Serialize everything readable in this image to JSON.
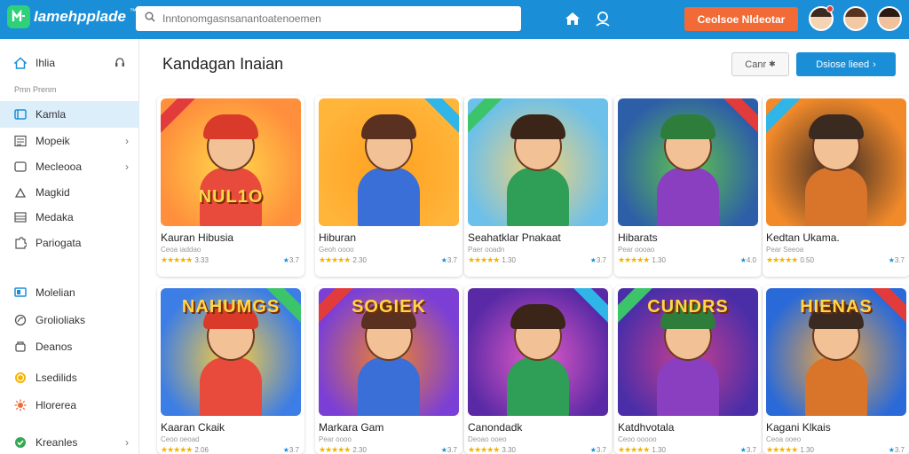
{
  "app": {
    "logo_text": "Iamehpplade",
    "logo_sup": "™",
    "search_placeholder": "Inntonomgasnsanantoatenoemen",
    "cta_label": "Ceolsoe Nldeotar"
  },
  "colors": {
    "topbar": "#1a8fd8",
    "accent": "#1a8fd8",
    "cta": "#f26a35",
    "active_item": "#ddeefb",
    "star": "#f4b400"
  },
  "sidebar": {
    "home_label": "Ihlia",
    "section_label": "Pmn Prenm",
    "items": [
      {
        "label": "Kamla",
        "icon": "book-icon",
        "active": true
      },
      {
        "label": "Mopeik",
        "icon": "list-icon",
        "chevron": true
      },
      {
        "label": "Mecleooa",
        "icon": "window-icon",
        "chevron": true
      },
      {
        "label": "Magkid",
        "icon": "triangle-icon"
      },
      {
        "label": "Medaka",
        "icon": "stack-icon"
      },
      {
        "label": "Pariogata",
        "icon": "puzzle-icon"
      },
      {
        "label": "Molelian",
        "icon": "screen-icon"
      },
      {
        "label": "Grolioliaks",
        "icon": "leaf-icon"
      },
      {
        "label": "Deanos",
        "icon": "box-icon"
      },
      {
        "label": "Lsedilids",
        "icon": "coin-icon"
      },
      {
        "label": "Hlorerea",
        "icon": "sun-icon"
      },
      {
        "label": "Kreanles",
        "icon": "check-icon",
        "chevron": true
      }
    ]
  },
  "main": {
    "title": "Kandagan Inaian",
    "secondary_button": "Canr",
    "primary_button": "Dsiose lieed"
  },
  "cards": [
    {
      "title": "Kauran Hibusia",
      "sub": "Ceoa iaddao",
      "rating_left": "3.33",
      "rating_right": "3.7",
      "art": "NUL1O",
      "tone": [
        "#ff8f3c",
        "#ffd84a"
      ]
    },
    {
      "title": "Hiburan",
      "sub": "Geoh oooo",
      "rating_left": "2.30",
      "rating_right": "3.7",
      "art": "",
      "tone": [
        "#ffb43a",
        "#ffa01f"
      ]
    },
    {
      "title": "Seahatklar Pnakaat",
      "sub": "Paer ooadn",
      "rating_left": "1.30",
      "rating_right": "3.7",
      "art": "",
      "tone": [
        "#6cc0ea",
        "#f3d27a"
      ]
    },
    {
      "title": "Hibarats",
      "sub": "Pear oooao",
      "rating_left": "1.30",
      "rating_right": "4.0",
      "art": "",
      "tone": [
        "#2d5ea8",
        "#5fc34c"
      ]
    },
    {
      "title": "Kedtan Ukama.",
      "sub": "Pear Seeoa",
      "rating_left": "0.50",
      "rating_right": "3.7",
      "art": "",
      "tone": [
        "#f28a2a",
        "#3b2a23"
      ]
    },
    {
      "title": "Kaaran Ckaik",
      "sub": "Ceoo oeoad",
      "rating_left": "2.06",
      "rating_right": "3.7",
      "art": "NAHUMGS",
      "tone": [
        "#3c7de6",
        "#ffce3b"
      ]
    },
    {
      "title": "Markara Gam",
      "sub": "Pear oooo",
      "rating_left": "2.30",
      "rating_right": "3.7",
      "art": "SOGIEK",
      "tone": [
        "#7b3fd6",
        "#f0822a"
      ]
    },
    {
      "title": "Canondadk",
      "sub": "Deoao ooeo",
      "rating_left": "3.30",
      "rating_right": "3.7",
      "art": "",
      "tone": [
        "#5a2aa6",
        "#e65bc7"
      ]
    },
    {
      "title": "Katdhvotala",
      "sub": "Ceoo ooooo",
      "rating_left": "1.30",
      "rating_right": "3.7",
      "art": "CUNDRS",
      "tone": [
        "#4a2ea8",
        "#c93f90"
      ]
    },
    {
      "title": "Kagani Klkais",
      "sub": "Ceoa ooeo",
      "rating_left": "1.30",
      "rating_right": "3.7",
      "art": "HIENAS",
      "tone": [
        "#2a6ad8",
        "#f2a640"
      ]
    }
  ]
}
